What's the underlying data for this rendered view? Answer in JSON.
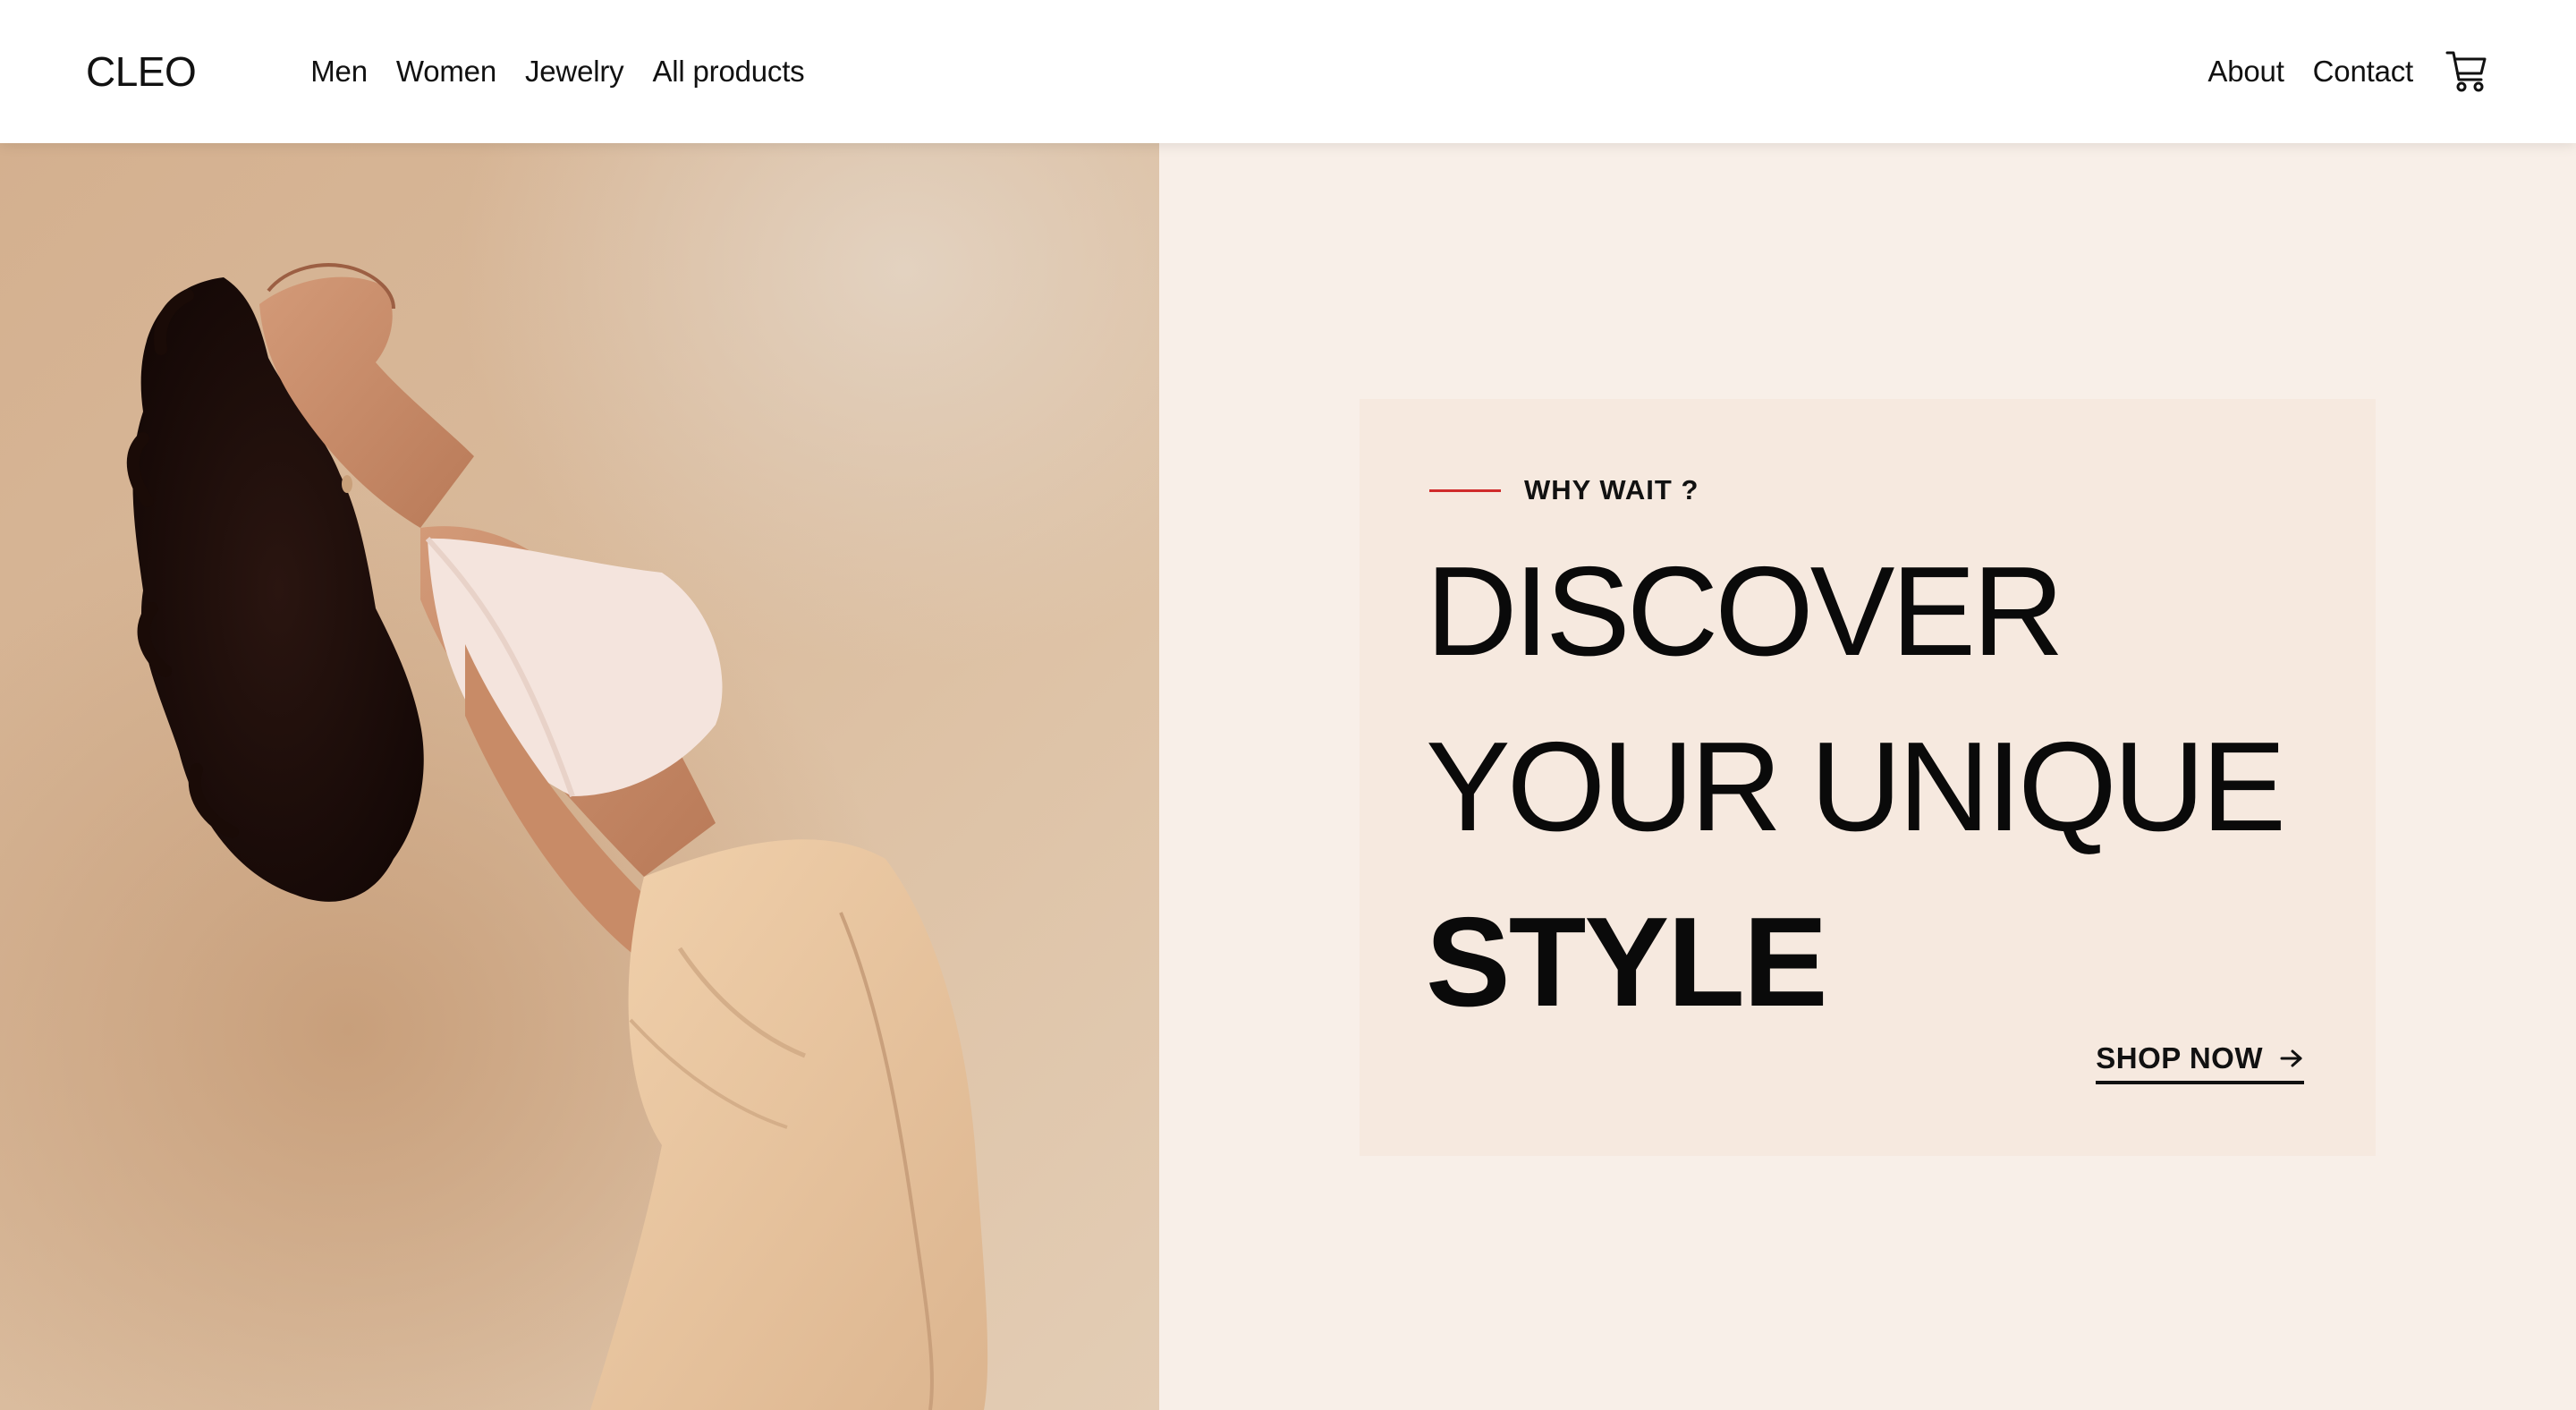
{
  "header": {
    "logo": "CLEO",
    "nav_left": [
      {
        "label": "Men"
      },
      {
        "label": "Women"
      },
      {
        "label": "Jewelry"
      },
      {
        "label": "All products"
      }
    ],
    "nav_right": [
      {
        "label": "About"
      },
      {
        "label": "Contact"
      }
    ],
    "cart_icon": "shopping-cart-icon"
  },
  "hero": {
    "image_alt": "hero-photo",
    "eyebrow": "WHY WAIT ?",
    "headline": {
      "line1": "DISCOVER",
      "line2": "YOUR UNIQUE",
      "line3": "STYLE"
    },
    "cta_label": "SHOP NOW",
    "cta_icon": "arrow-right-icon"
  },
  "colors": {
    "accent": "#d02b2b",
    "background": "#f8efe8",
    "card": "#f6e9df",
    "header_bg": "#ffffff",
    "text": "#111111"
  }
}
